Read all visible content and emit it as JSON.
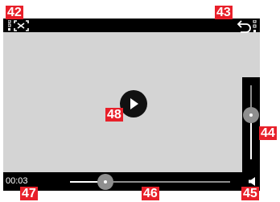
{
  "player": {
    "current_time": "00:03",
    "progress": 0.22,
    "volume": 0.55
  },
  "callouts": {
    "fullscreen": "42",
    "back": "43",
    "volume_slider": "44",
    "volume_icon": "45",
    "seek_bar": "46",
    "time": "47",
    "play": "48"
  },
  "icons": {
    "fullscreen": "fullscreen-icon",
    "back": "back-arrow-icon",
    "play": "play-icon",
    "volume": "speaker-icon"
  },
  "colors": {
    "callout": "#e8202a",
    "bar": "#000000",
    "screen": "#d4d4d4",
    "knob": "#8f8f8f"
  }
}
